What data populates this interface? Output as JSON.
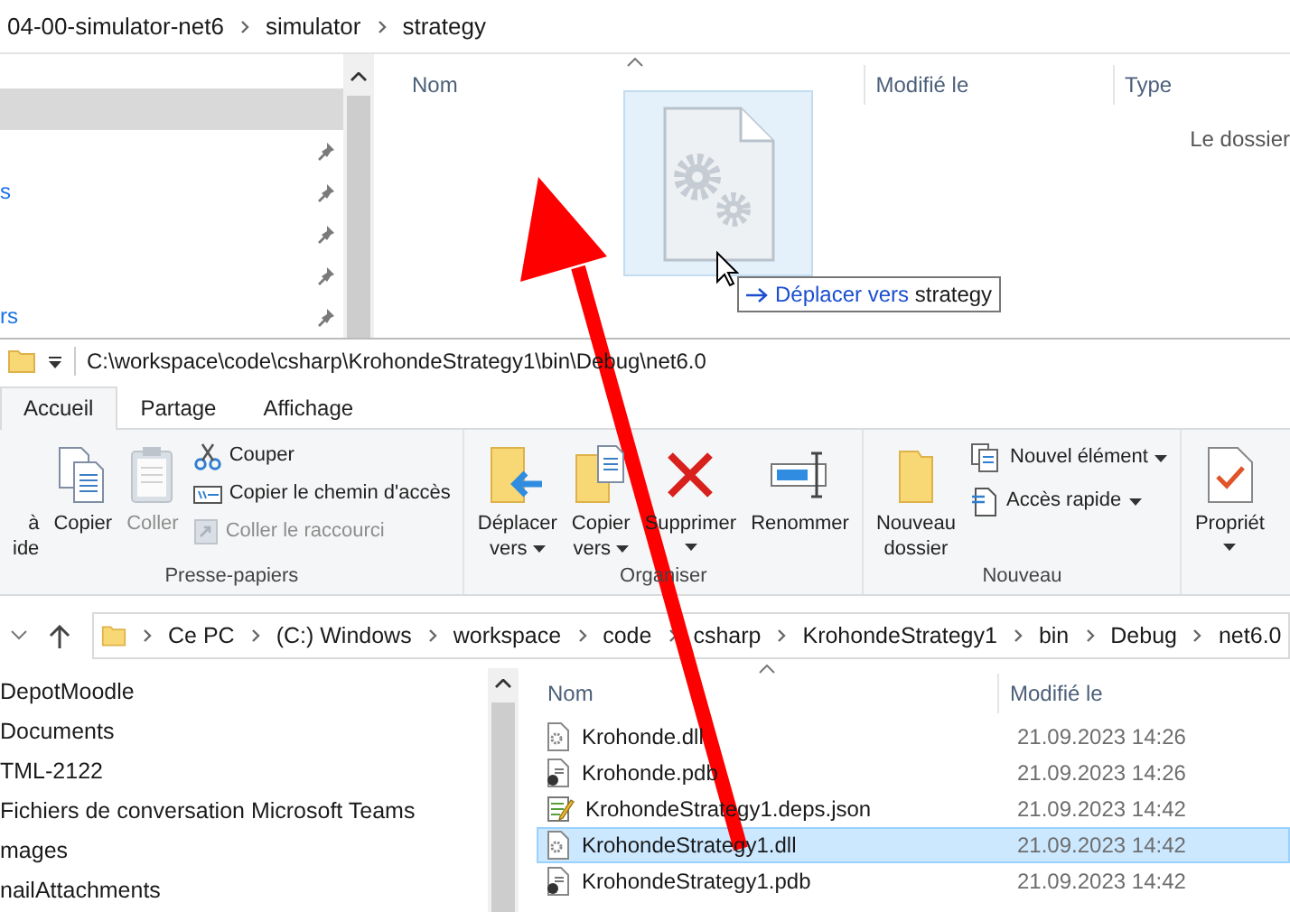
{
  "top_window": {
    "breadcrumb": [
      "04-00-simulator-net6",
      "simulator",
      "strategy"
    ],
    "nav_rows": [
      {
        "selected": true,
        "pinned": false
      },
      {
        "selected": false,
        "pinned": true
      },
      {
        "selected": false,
        "pinned": true,
        "label": "s"
      },
      {
        "selected": false,
        "pinned": true
      },
      {
        "selected": false,
        "pinned": true
      },
      {
        "selected": false,
        "pinned": true,
        "label": "rs"
      }
    ],
    "columns": [
      {
        "label": "Nom",
        "sorted": true
      },
      {
        "label": "Modifié le",
        "sorted": false
      },
      {
        "label": "Type",
        "sorted": false
      }
    ],
    "empty_message": "Le dossier"
  },
  "drag": {
    "tooltip": {
      "action": "Déplacer vers",
      "target": "strategy"
    }
  },
  "bottom_window": {
    "title": "C:\\workspace\\code\\csharp\\KrohondeStrategy1\\bin\\Debug\\net6.0",
    "tabs": [
      {
        "label": "Accueil",
        "selected": true
      },
      {
        "label": "Partage",
        "selected": false
      },
      {
        "label": "Affichage",
        "selected": false
      }
    ],
    "ribbon_groups": [
      {
        "label": "Presse-papiers",
        "items": [
          {
            "kind": "large",
            "lines": [
              "à",
              "ide"
            ],
            "disabled": false,
            "dropdown": false
          },
          {
            "kind": "large",
            "lines": [
              "Copier"
            ],
            "disabled": false,
            "dropdown": false
          },
          {
            "kind": "large",
            "lines": [
              "Coller"
            ],
            "disabled": true,
            "dropdown": false
          },
          {
            "kind": "stack",
            "entries": [
              {
                "label": "Couper",
                "disabled": false,
                "dropdown": false
              },
              {
                "label": "Copier le chemin d'accès",
                "disabled": false,
                "dropdown": false
              },
              {
                "label": "Coller le raccourci",
                "disabled": true,
                "dropdown": false
              }
            ]
          }
        ]
      },
      {
        "label": "Organiser",
        "items": [
          {
            "kind": "large",
            "lines": [
              "Déplacer",
              "vers"
            ],
            "disabled": false,
            "dropdown": true
          },
          {
            "kind": "large",
            "lines": [
              "Copier",
              "vers"
            ],
            "disabled": false,
            "dropdown": true
          },
          {
            "kind": "large",
            "lines": [
              "Supprimer"
            ],
            "disabled": false,
            "dropdown": true
          },
          {
            "kind": "large",
            "lines": [
              "Renommer"
            ],
            "disabled": false,
            "dropdown": false
          }
        ]
      },
      {
        "label": "Nouveau",
        "items": [
          {
            "kind": "large",
            "lines": [
              "Nouveau",
              "dossier"
            ],
            "disabled": false,
            "dropdown": false
          },
          {
            "kind": "stack",
            "entries": [
              {
                "label": "Nouvel élément",
                "disabled": false,
                "dropdown": true
              },
              {
                "label": "Accès rapide",
                "disabled": false,
                "dropdown": true
              }
            ]
          }
        ]
      },
      {
        "items": [
          {
            "kind": "large",
            "lines": [
              "Propriét"
            ],
            "disabled": false,
            "dropdown": true
          }
        ]
      }
    ],
    "address": [
      "Ce PC",
      "(C:) Windows",
      "workspace",
      "code",
      "csharp",
      "KrohondeStrategy1",
      "bin",
      "Debug",
      "net6.0"
    ],
    "nav_items": [
      "DepotMoodle",
      "Documents",
      "TML-2122",
      "Fichiers de conversation Microsoft Teams",
      "mages",
      "nailAttachments"
    ],
    "columns": [
      {
        "label": "Nom",
        "sorted": true
      },
      {
        "label": "Modifié le",
        "sorted": false
      }
    ],
    "files": [
      {
        "name": "Krohonde.dll",
        "modified": "21.09.2023 14:26",
        "kind": "dll",
        "selected": false
      },
      {
        "name": "Krohonde.pdb",
        "modified": "21.09.2023 14:26",
        "kind": "pdb",
        "selected": false
      },
      {
        "name": "KrohondeStrategy1.deps.json",
        "modified": "21.09.2023 14:42",
        "kind": "json",
        "selected": false
      },
      {
        "name": "KrohondeStrategy1.dll",
        "modified": "21.09.2023 14:42",
        "kind": "dll",
        "selected": true
      },
      {
        "name": "KrohondeStrategy1.pdb",
        "modified": "21.09.2023 14:42",
        "kind": "pdb",
        "selected": false
      }
    ]
  }
}
